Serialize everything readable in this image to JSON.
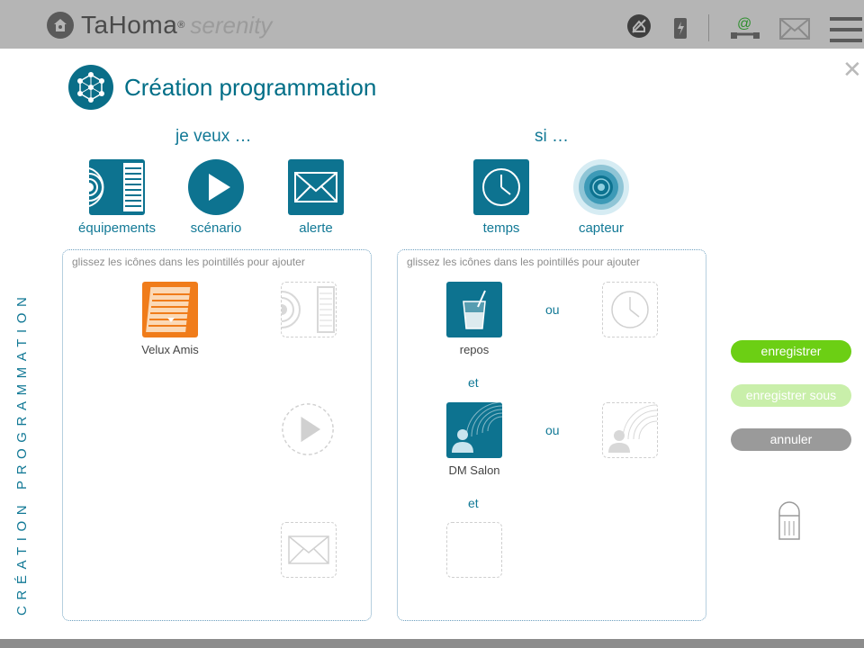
{
  "header": {
    "brand": "TaHoma",
    "registered": "®",
    "subbrand": "serenity",
    "icons": [
      "home-logo-icon",
      "no-connection-icon",
      "battery-icon",
      "user-network-icon",
      "mail-icon",
      "menu-icon"
    ]
  },
  "dialog": {
    "title": "Création programmation",
    "side_label": "CRÉATION PROGRAMMATION",
    "close_icon": "close-icon"
  },
  "actions": {
    "heading": "je veux …",
    "tools": [
      {
        "label": "équipements",
        "icon": "equipment-icon"
      },
      {
        "label": "scénario",
        "icon": "play-icon"
      },
      {
        "label": "alerte",
        "icon": "envelope-icon"
      }
    ],
    "zone_hint": "glissez les icônes dans les pointillés pour ajouter",
    "placed_item": {
      "label": "Velux Amis",
      "icon": "blind-icon"
    }
  },
  "conditions": {
    "heading": "si …",
    "tools": [
      {
        "label": "temps",
        "icon": "clock-icon"
      },
      {
        "label": "capteur",
        "icon": "sensor-icon"
      }
    ],
    "zone_hint": "glissez les icônes dans les pointillés pour ajouter",
    "items": [
      {
        "label": "repos",
        "icon": "drink-icon"
      },
      {
        "label": "DM Salon",
        "icon": "presence-sensor-icon"
      }
    ],
    "or_label": "ou",
    "and_label": "et"
  },
  "buttons": {
    "save": "enregistrer",
    "save_as": "enregistrer sous",
    "cancel": "annuler"
  },
  "colors": {
    "primary": "#0d7390",
    "save": "#6ccf14",
    "save_as": "#c9efaa",
    "cancel": "#9a9a9a",
    "orange": "#f07c1a"
  }
}
